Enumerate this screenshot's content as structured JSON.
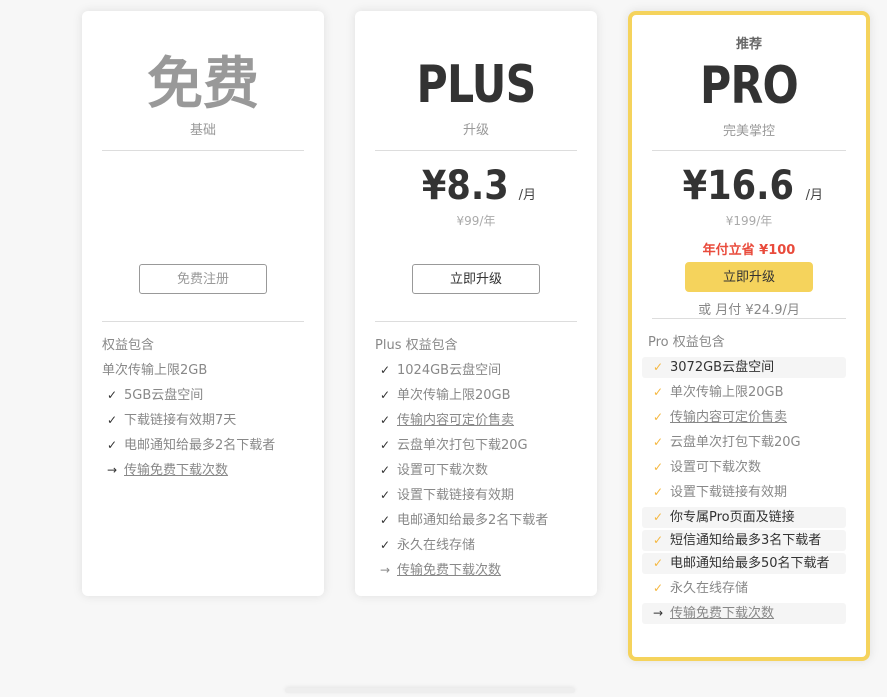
{
  "plans": {
    "free": {
      "title": "免费",
      "subtitle": "基础",
      "button": "免费注册",
      "benefits_header": "权益包含",
      "benefits": [
        {
          "text": "单次传输上限2GB",
          "icon": "none"
        },
        {
          "text": "5GB云盘空间",
          "icon": "check-icon"
        },
        {
          "text": "下载链接有效期7天",
          "icon": "check-icon"
        },
        {
          "text": "电邮通知给最多2名下载者",
          "icon": "check-icon"
        },
        {
          "text": "传输免费下载次数",
          "icon": "arrow-right-icon"
        }
      ]
    },
    "plus": {
      "title": "PLUS",
      "subtitle": "升级",
      "price": "¥8.3",
      "per": "/月",
      "original": "¥99/年",
      "button": "立即升级",
      "benefits_header": "Plus 权益包含",
      "benefits": [
        {
          "text": "1024GB云盘空间",
          "icon": "check-icon"
        },
        {
          "text": "单次传输上限20GB",
          "icon": "check-icon"
        },
        {
          "text": "传输内容可定价售卖",
          "icon": "check-icon"
        },
        {
          "text": "云盘单次打包下载20G",
          "icon": "check-icon"
        },
        {
          "text": "设置可下载次数",
          "icon": "check-icon"
        },
        {
          "text": "设置下载链接有效期",
          "icon": "check-icon"
        },
        {
          "text": "电邮通知给最多2名下载者",
          "icon": "check-icon"
        },
        {
          "text": "永久在线存储",
          "icon": "check-icon"
        },
        {
          "text": "传输免费下载次数",
          "icon": "arrow-right-icon"
        }
      ]
    },
    "pro": {
      "badge": "推荐",
      "title": "PRO",
      "subtitle": "完美掌控",
      "price": "¥16.6",
      "per": "/月",
      "original": "¥199/年",
      "save": "年付立省 ¥100",
      "button": "立即升级",
      "monthly": "或 月付 ¥24.9/月",
      "benefits_header": "Pro 权益包含",
      "benefits": [
        {
          "text": "3072GB云盘空间",
          "icon": "check-icon"
        },
        {
          "text": "单次传输上限20GB",
          "icon": "check-icon"
        },
        {
          "text": "传输内容可定价售卖",
          "icon": "check-icon"
        },
        {
          "text": "云盘单次打包下载20G",
          "icon": "check-icon"
        },
        {
          "text": "设置可下载次数",
          "icon": "check-icon"
        },
        {
          "text": "设置下载链接有效期",
          "icon": "check-icon"
        },
        {
          "text": "你专属Pro页面及链接",
          "icon": "check-icon"
        },
        {
          "text": "短信通知给最多3名下载者",
          "icon": "check-icon"
        },
        {
          "text": "电邮通知给最多50名下载者",
          "icon": "check-icon"
        },
        {
          "text": "永久在线存储",
          "icon": "check-icon"
        },
        {
          "text": "传输免费下载次数",
          "icon": "arrow-right-icon"
        }
      ]
    }
  },
  "colors": {
    "accent": "#f5d35c",
    "check": "#f5b841",
    "save": "#e94b3c"
  }
}
